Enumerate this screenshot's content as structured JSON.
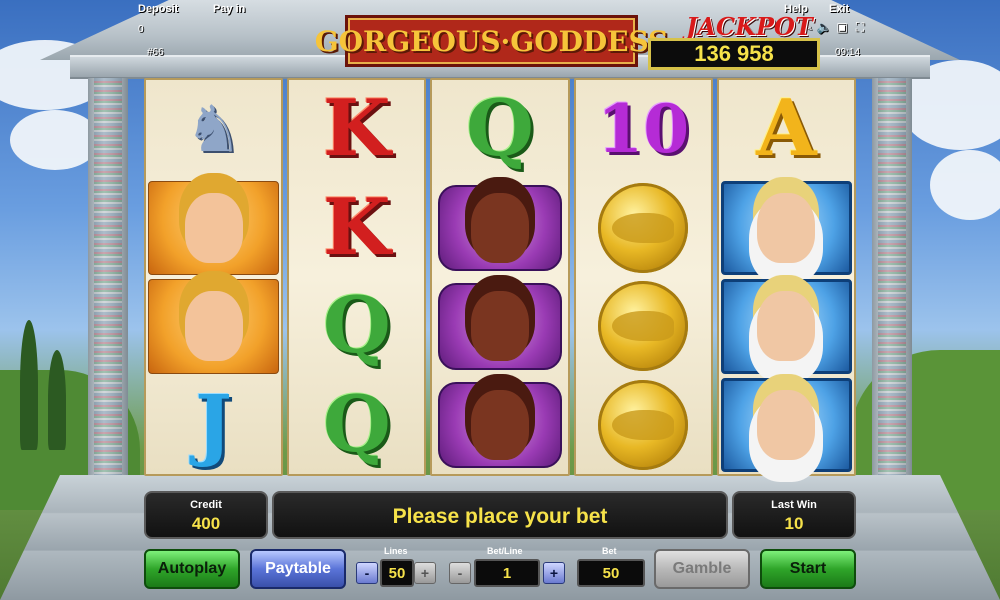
{
  "topbar": {
    "deposit_label": "Deposit",
    "deposit_value": "0",
    "payin_label": "Pay in",
    "help_label": "Help",
    "exit_label": "Exit",
    "game_number": "#66",
    "time": "09:14"
  },
  "title": "GORGEOUS·GODDESS",
  "jackpot": {
    "label": "JACKPOT",
    "value": "136 958"
  },
  "reels": [
    [
      "pegasus-statue",
      "goddess",
      "goddess",
      "J"
    ],
    [
      "K",
      "K",
      "Q",
      "Q"
    ],
    [
      "Q",
      "warrior",
      "warrior",
      "warrior"
    ],
    [
      "10",
      "coin",
      "coin",
      "coin"
    ],
    [
      "A",
      "zeus",
      "zeus",
      "zeus"
    ]
  ],
  "symbols": {
    "J": "J",
    "K": "K",
    "Q": "Q",
    "ten": "10",
    "A": "A"
  },
  "panels": {
    "credit_label": "Credit",
    "credit_value": "400",
    "message": "Please place your bet",
    "lastwin_label": "Last Win",
    "lastwin_value": "10"
  },
  "controls": {
    "autoplay_label": "Autoplay",
    "paytable_label": "Paytable",
    "lines_label": "Lines",
    "lines_value": "50",
    "betline_label": "Bet/Line",
    "betline_value": "1",
    "bet_label": "Bet",
    "bet_value": "50",
    "gamble_label": "Gamble",
    "start_label": "Start",
    "minus": "-",
    "plus": "+"
  },
  "colors": {
    "message_text": "#f6e24a",
    "start_button": "#2fa52a",
    "paytable_button": "#5a74d8",
    "gamble_button_disabled": "#b8b8b8"
  }
}
